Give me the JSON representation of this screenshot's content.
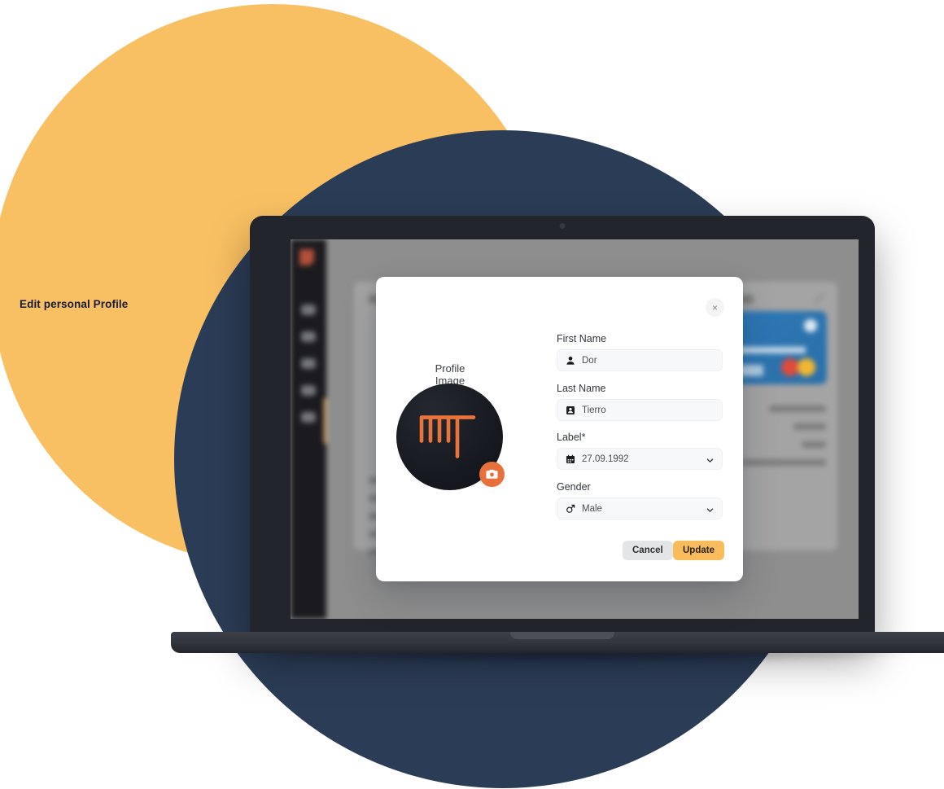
{
  "background": {
    "yellow_circle_color": "#f9c063",
    "navy_circle_color": "#2b3c56"
  },
  "device": {
    "type": "laptop",
    "bezel_color": "#22252b",
    "screen_bg": "#8e8e8e"
  },
  "app_behind": {
    "sidebar_icon_count": 5,
    "left_card_title": "Personal Profile",
    "right_card_title": "Cards",
    "card_brand": "Mastercard"
  },
  "modal": {
    "title": "Edit personal Profile",
    "close_icon": "close-icon",
    "close_label": "×",
    "profile": {
      "image_label": "Profile Image",
      "avatar_bg": "#16191f",
      "avatar_logo_color": "#e8743c",
      "camera_badge_color": "#e8703a",
      "camera_icon": "camera-icon"
    },
    "fields": [
      {
        "label": "First Name",
        "value": "Dor",
        "icon": "person-icon",
        "type": "text",
        "has_chevron": false
      },
      {
        "label": "Last Name",
        "value": "Tierro",
        "icon": "contact-card-icon",
        "type": "text",
        "has_chevron": false
      },
      {
        "label": "Label*",
        "value": "27.09.1992",
        "icon": "calendar-icon",
        "type": "select",
        "has_chevron": true
      },
      {
        "label": "Gender",
        "value": "Male",
        "icon": "mars-icon",
        "type": "select",
        "has_chevron": true
      }
    ],
    "actions": {
      "cancel_label": "Cancel",
      "update_label": "Update",
      "cancel_color": "#e4e5e7",
      "update_color": "#f8bc5d"
    }
  }
}
